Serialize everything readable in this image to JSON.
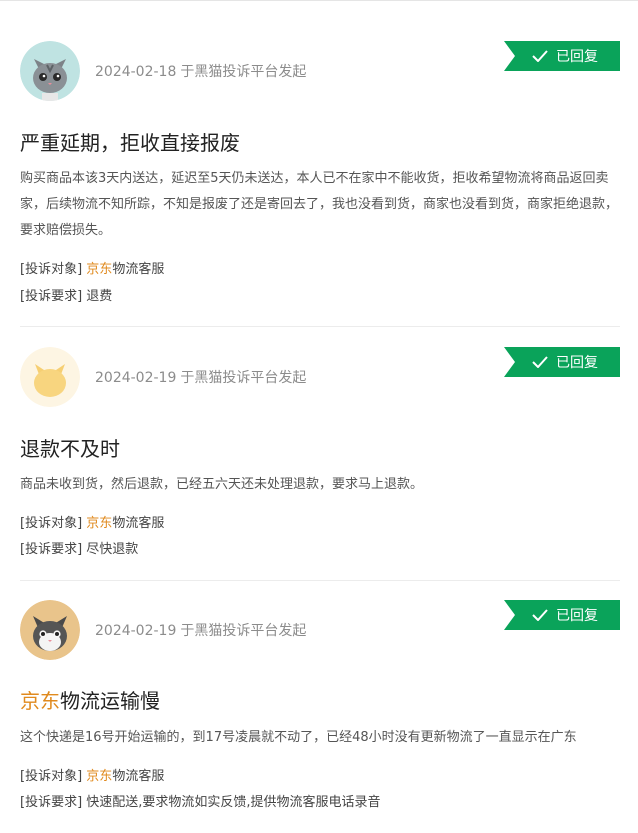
{
  "complaints": [
    {
      "date": "2024-02-18",
      "source": "于黑猫投诉平台发起",
      "status": "已回复",
      "title_brand": "",
      "title": "严重延期，拒收直接报废",
      "description": "购买商品本该3天内送达，延迟至5天仍未送达，本人已不在家中不能收货，拒收希望物流将商品返回卖家，后续物流不知所踪，不知是报废了还是寄回去了，我也没看到货，商家也没看到货，商家拒绝退款，要求赔偿损失。",
      "target_label": "[投诉对象]",
      "target_brand": "京东",
      "target_rest": "物流客服",
      "demand_label": "[投诉要求]",
      "demand": "退费",
      "avatar_icon": "gray-cat-avatar-icon"
    },
    {
      "date": "2024-02-19",
      "source": "于黑猫投诉平台发起",
      "status": "已回复",
      "title_brand": "",
      "title": "退款不及时",
      "description": "商品未收到货，然后退款，已经五六天还未处理退款，要求马上退款。",
      "target_label": "[投诉对象]",
      "target_brand": "京东",
      "target_rest": "物流客服",
      "demand_label": "[投诉要求]",
      "demand": "尽快退款",
      "avatar_icon": "yellow-cat-avatar-icon"
    },
    {
      "date": "2024-02-19",
      "source": "于黑猫投诉平台发起",
      "status": "已回复",
      "title_brand": "京东",
      "title": "物流运输慢",
      "description": "这个快递是16号开始运输的，到17号凌晨就不动了，已经48小时没有更新物流了一直显示在广东",
      "target_label": "[投诉对象]",
      "target_brand": "京东",
      "target_rest": "物流客服",
      "demand_label": "[投诉要求]",
      "demand": "快速配送,要求物流如实反馈,提供物流客服电话录音",
      "avatar_icon": "tan-cat-avatar-icon"
    }
  ],
  "colors": {
    "badge": "#0aa35a",
    "brand": "#e08a1e",
    "meta": "#8c8c8c"
  }
}
